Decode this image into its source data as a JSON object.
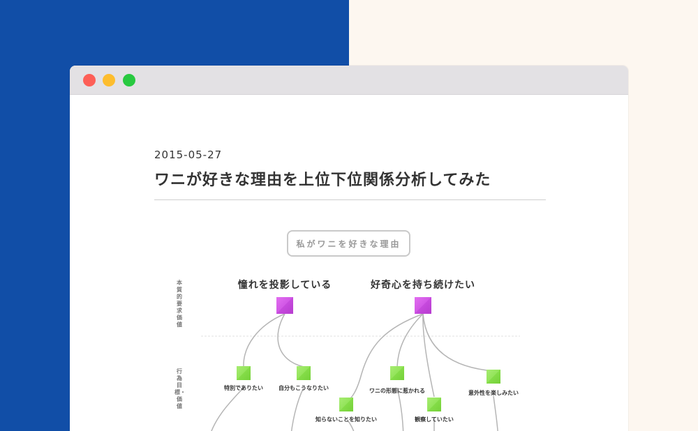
{
  "window": {
    "controls": [
      "close",
      "minimize",
      "maximize"
    ]
  },
  "post": {
    "date": "2015-05-27",
    "title": "ワニが好きな理由を上位下位関係分析してみた"
  },
  "diagram": {
    "root": "私がワニを好きな理由",
    "axis_labels": {
      "top": "本質的要求価値",
      "bottom": "行為目標・価値"
    },
    "top_nodes": [
      {
        "label": "憧れを投影している"
      },
      {
        "label": "好奇心を持ち続けたい"
      }
    ],
    "sub_nodes": [
      {
        "label": "特別でありたい"
      },
      {
        "label": "自分もこうなりたい"
      },
      {
        "label": "ワニの形態に惹かれる"
      },
      {
        "label": "意外性を楽しみたい"
      },
      {
        "label": "知らないことを知りたい"
      },
      {
        "label": "観察していたい"
      }
    ],
    "colors": {
      "top_node": "#d157e6",
      "sub_node": "#8fe052",
      "connector": "#b5b5b5"
    }
  }
}
